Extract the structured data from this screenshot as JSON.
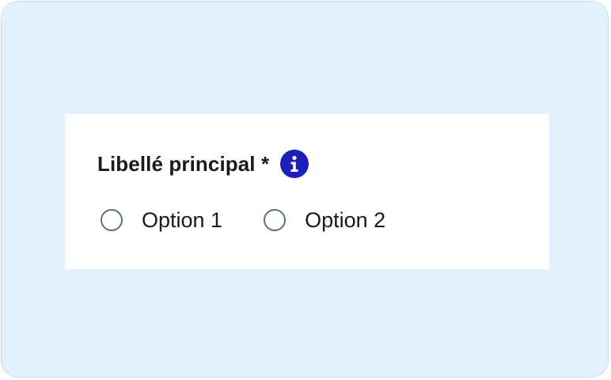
{
  "field": {
    "label": "Libellé principal *",
    "info_icon": "info-icon"
  },
  "options": [
    {
      "label": "Option 1",
      "selected": false
    },
    {
      "label": "Option 2",
      "selected": false
    }
  ],
  "colors": {
    "background": "#e3f0fe",
    "card": "#ffffff",
    "info_icon": "#1e1fb8",
    "radio_border": "#5f6f7e",
    "text": "#1a1a1a"
  }
}
